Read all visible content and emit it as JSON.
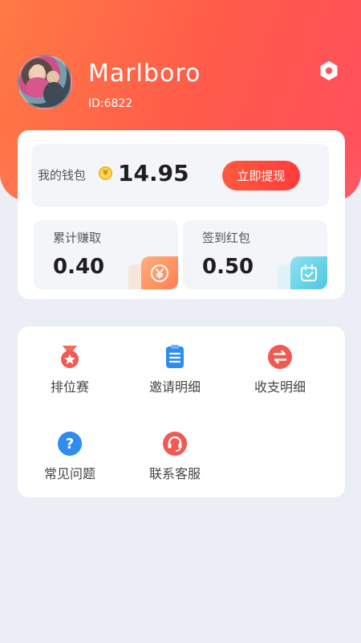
{
  "user": {
    "name": "Marlboro",
    "id_text": "ID:6822"
  },
  "wallet": {
    "label": "我的钱包",
    "coin_symbol": "¥",
    "amount": "14.95",
    "withdraw_label": "立即提现"
  },
  "stats": {
    "earned": {
      "label": "累计赚取",
      "value": "0.40",
      "icon": "yen-icon"
    },
    "signin": {
      "label": "签到红包",
      "value": "0.50",
      "icon": "calendar-check-icon"
    }
  },
  "menu": {
    "items": [
      {
        "label": "排位赛",
        "icon": "medal-icon",
        "color": "#f05a52"
      },
      {
        "label": "邀请明细",
        "icon": "clipboard-list-icon",
        "color": "#2f8cf0"
      },
      {
        "label": "收支明细",
        "icon": "swap-arrows-icon",
        "color": "#f05a52"
      },
      {
        "label": "常见问题",
        "icon": "question-icon",
        "color": "#2f8cf0"
      },
      {
        "label": "联系客服",
        "icon": "headset-icon",
        "color": "#f05a52"
      }
    ]
  },
  "colors": {
    "header_gradient_start": "#ff7a45",
    "header_gradient_end": "#ff4f5e",
    "accent_red": "#ff3b3b",
    "background": "#eceef5"
  }
}
